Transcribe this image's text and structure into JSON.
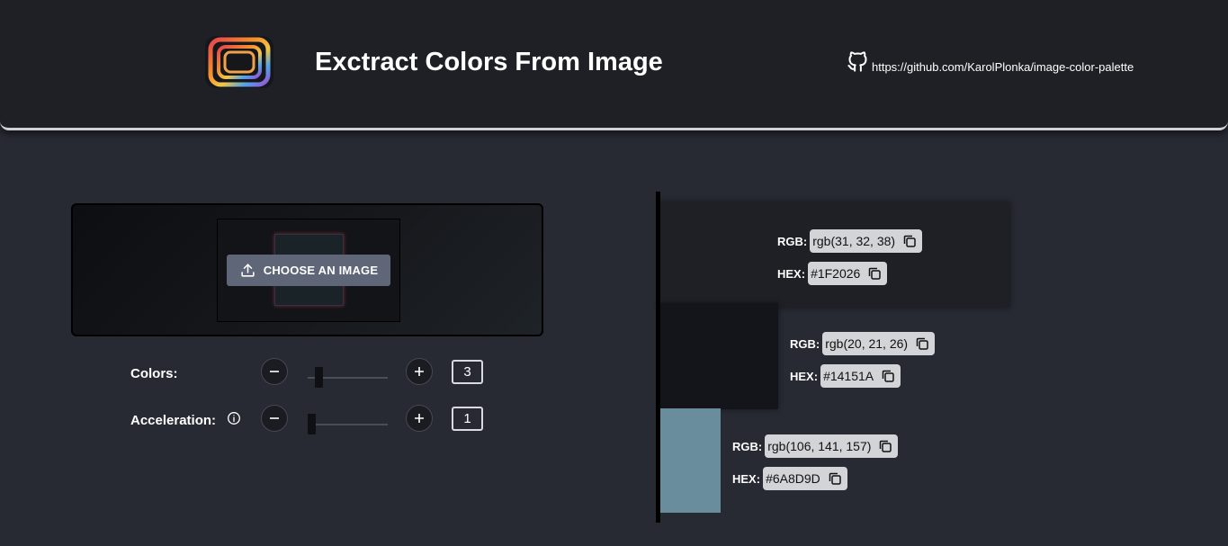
{
  "header": {
    "title": "Exctract Colors From Image",
    "repo_link": "https://github.com/KarolPlonka/image-color-palette",
    "logo_icon": "rainbow-frame-logo-icon",
    "github_icon": "github-icon"
  },
  "upload": {
    "button_label": "CHOOSE AN IMAGE",
    "button_icon": "upload-icon"
  },
  "controls": {
    "colors": {
      "label": "Colors:",
      "value": "3",
      "slider_fraction": 0.1
    },
    "acceleration": {
      "label": "Acceleration:",
      "value": "1",
      "slider_fraction": 0.0,
      "info_icon": "info-icon"
    },
    "decrement_icon": "minus-icon",
    "increment_icon": "plus-icon"
  },
  "palette": [
    {
      "color": "#1F2026",
      "rgb_key": "RGB:",
      "rgb": "rgb(31, 32, 38)",
      "hex_key": "HEX:",
      "hex": "#1F2026",
      "share_percent": 100
    },
    {
      "color": "#14151A",
      "rgb_key": "RGB:",
      "rgb": "rgb(20, 21, 26)",
      "hex_key": "HEX:",
      "hex": "#14151A",
      "share_percent": 34
    },
    {
      "color": "#6A8D9D",
      "rgb_key": "RGB:",
      "rgb": "rgb(106, 141, 157)",
      "hex_key": "HEX:",
      "hex": "#6A8D9D",
      "share_percent": 17
    }
  ],
  "copy_icon": "copy-icon",
  "colors": {
    "page_background": "#272a33",
    "header_background": "#1e2026",
    "button_background": "#5f6678",
    "chip_background": "#d3d4d8"
  }
}
